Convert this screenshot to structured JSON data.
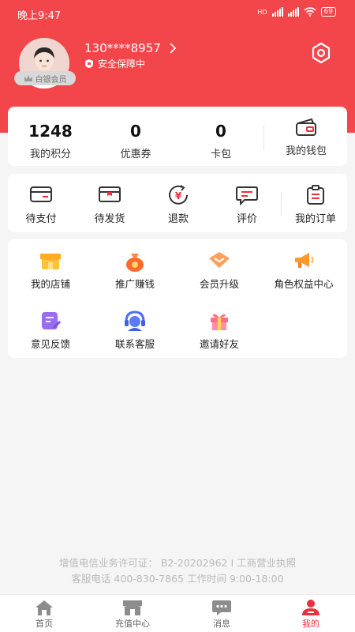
{
  "status": {
    "time": "晚上9:47",
    "hd_label": "HD",
    "battery": "69"
  },
  "profile": {
    "phone": "130****8957",
    "security": "安全保障中",
    "member_badge": "白银会员"
  },
  "stats": [
    {
      "value": "1248",
      "label": "我的积分"
    },
    {
      "value": "0",
      "label": "优惠券"
    },
    {
      "value": "0",
      "label": "卡包"
    },
    {
      "label": "我的钱包"
    }
  ],
  "orders": [
    {
      "label": "待支付"
    },
    {
      "label": "待发货"
    },
    {
      "label": "退款"
    },
    {
      "label": "评价"
    },
    {
      "label": "我的订单"
    }
  ],
  "services": [
    {
      "label": "我的店铺"
    },
    {
      "label": "推广赚钱"
    },
    {
      "label": "会员升级"
    },
    {
      "label": "角色权益中心"
    },
    {
      "label": "意见反馈"
    },
    {
      "label": "联系客服"
    },
    {
      "label": "邀请好友"
    }
  ],
  "footer": {
    "license": "增值电信业务许可证： B2-20202962 I 工商营业执照",
    "service": "客服电话 400-830-7865 工作时间 9:00-18:00"
  },
  "tabs": [
    {
      "label": "首页"
    },
    {
      "label": "充值中心"
    },
    {
      "label": "消息"
    },
    {
      "label": "我的"
    }
  ],
  "colors": {
    "brand_red": "#f2464a",
    "tab_active": "#e8313c"
  }
}
